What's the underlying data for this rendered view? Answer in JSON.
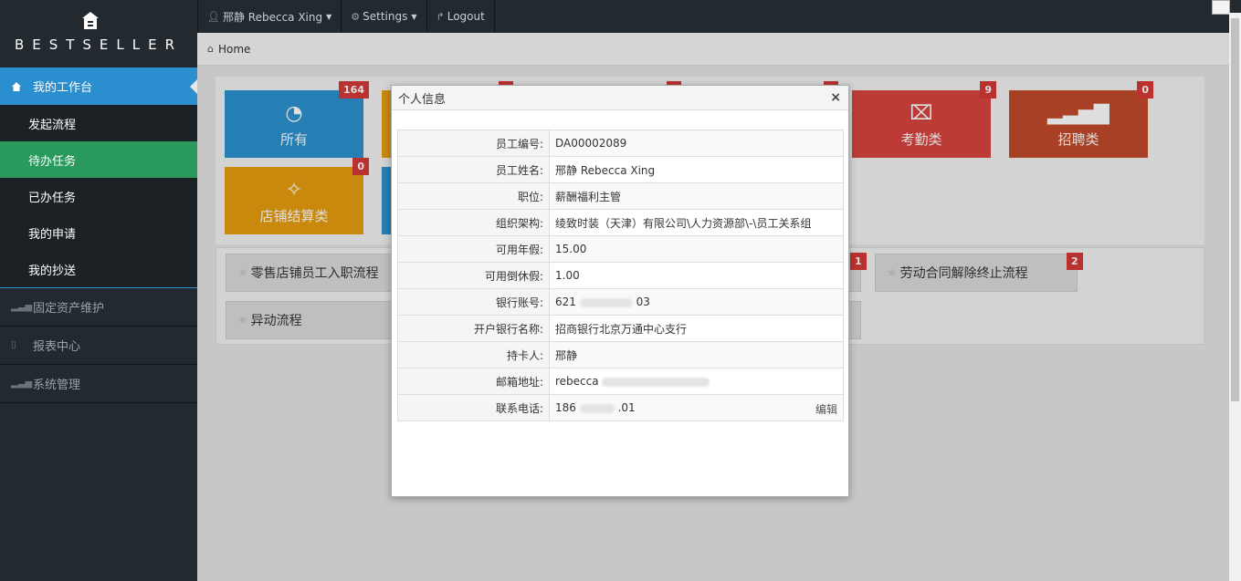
{
  "sidebar": {
    "brand": "BESTSELLER",
    "main_label": "我的工作台",
    "sub_items": [
      {
        "label": "发起流程"
      },
      {
        "label": "待办任务"
      },
      {
        "label": "已办任务"
      },
      {
        "label": "我的申请"
      },
      {
        "label": "我的抄送"
      }
    ],
    "groups": [
      {
        "label": "固定资产维护"
      },
      {
        "label": "报表中心"
      },
      {
        "label": "系统管理"
      }
    ]
  },
  "topbar": {
    "user": "邢静 Rebecca Xing",
    "settings": "Settings",
    "logout": "Logout"
  },
  "breadcrumb": {
    "home": "Home"
  },
  "tiles": [
    {
      "label": "所有",
      "badge": "164",
      "color": "#2b92d0"
    },
    {
      "label": "考勤类",
      "badge": "9",
      "color": "#d9443f"
    },
    {
      "label": "招聘类",
      "badge": "0",
      "color": "#c04a2a"
    },
    {
      "label": "店铺结算类",
      "badge": "0",
      "color": "#e79e0f"
    }
  ],
  "flows": [
    {
      "label": "零售店铺员工入职流程"
    },
    {
      "label": "劳动合同解除终止流程",
      "badge": "2"
    },
    {
      "label": "异动流程"
    }
  ],
  "flow_badge_hidden": "1",
  "modal": {
    "title": "个人信息",
    "close": "×",
    "rows": [
      {
        "key": "员工编号:",
        "value": "DA00002089"
      },
      {
        "key": "员工姓名:",
        "value": "邢静 Rebecca Xing"
      },
      {
        "key": "职位:",
        "value": "薪酬福利主管"
      },
      {
        "key": "组织架构:",
        "value": "绫致时装（天津）有限公司\\人力资源部\\-\\员工关系组"
      },
      {
        "key": "可用年假:",
        "value": "15.00"
      },
      {
        "key": "可用倒休假:",
        "value": "1.00"
      },
      {
        "key": "银行账号:",
        "value_start": "621",
        "value_end": "03"
      },
      {
        "key": "开户银行名称:",
        "value": "招商银行北京万通中心支行"
      },
      {
        "key": "持卡人:",
        "value": "邢静"
      },
      {
        "key": "邮箱地址:",
        "value_start": "rebecca"
      },
      {
        "key": "联系电话:",
        "value_start": "186",
        "value_end": ".01",
        "action": "编辑"
      }
    ]
  }
}
